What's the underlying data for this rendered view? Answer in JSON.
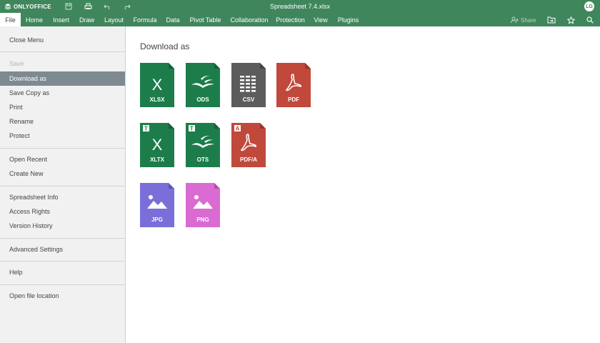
{
  "app": {
    "brand": "ONLYOFFICE",
    "document_title": "Spreadsheet 7.4.xlsx",
    "user_initials": "LG"
  },
  "quick_access": [
    {
      "icon": "save-icon"
    },
    {
      "icon": "print-icon"
    },
    {
      "icon": "undo-icon"
    },
    {
      "icon": "redo-icon"
    }
  ],
  "tabs": [
    "File",
    "Home",
    "Insert",
    "Draw",
    "Layout",
    "Formula",
    "Data",
    "Pivot Table",
    "Collaboration",
    "Protection",
    "View",
    "Plugins"
  ],
  "active_tab": "File",
  "toolbar_right": {
    "share_label": "Share"
  },
  "file_menu": {
    "items": [
      "Close Menu",
      "Save",
      "Download as",
      "Save Copy as",
      "Print",
      "Rename",
      "Protect",
      "Open Recent",
      "Create New",
      "Spreadsheet Info",
      "Access Rights",
      "Version History",
      "Advanced Settings",
      "Help",
      "Open file location"
    ],
    "selected": "Download as",
    "disabled": [
      "Save"
    ]
  },
  "download": {
    "heading": "Download as",
    "formats": [
      {
        "label": "XLSX",
        "color": "#1c7d4a",
        "glyph": "X",
        "template": false
      },
      {
        "label": "ODS",
        "color": "#1c7d4a",
        "glyph": "gulls",
        "template": false
      },
      {
        "label": "CSV",
        "color": "#5c5c5c",
        "glyph": "grid",
        "template": false
      },
      {
        "label": "PDF",
        "color": "#c0493c",
        "glyph": "acrobat",
        "template": false
      },
      {
        "label": "XLTX",
        "color": "#1c7d4a",
        "glyph": "X",
        "template": true,
        "badge": "T"
      },
      {
        "label": "OTS",
        "color": "#1c7d4a",
        "glyph": "gulls",
        "template": true,
        "badge": "T"
      },
      {
        "label": "PDF/A",
        "color": "#c0493c",
        "glyph": "acrobat",
        "template": true,
        "badge": "A"
      },
      {
        "label": "JPG",
        "color": "#7a6fd8",
        "glyph": "image",
        "template": false
      },
      {
        "label": "PNG",
        "color": "#da6bd3",
        "glyph": "image",
        "template": false
      }
    ]
  }
}
